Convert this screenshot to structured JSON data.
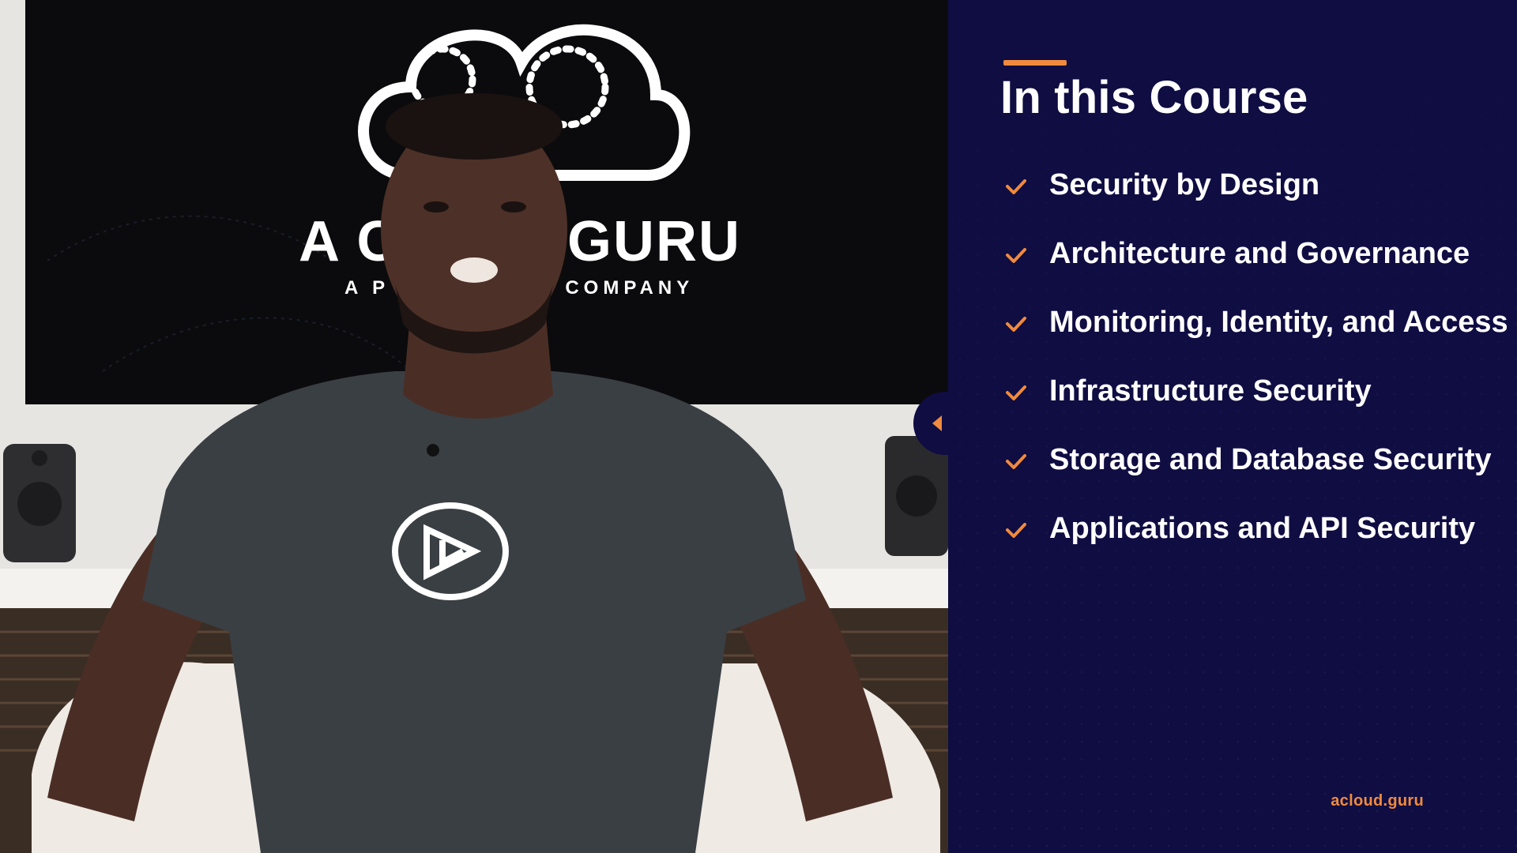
{
  "video": {
    "backdrop_logo_text": "A CLOUD GURU",
    "backdrop_tagline": "A PLURALSIGHT COMPANY"
  },
  "panel": {
    "title": "In this Course",
    "items": [
      {
        "label": "Security by Design",
        "icon": "check-icon"
      },
      {
        "label": "Architecture and Governance",
        "icon": "check-icon"
      },
      {
        "label": "Monitoring, Identity, and Access",
        "icon": "check-icon"
      },
      {
        "label": "Infrastructure Security",
        "icon": "check-icon"
      },
      {
        "label": "Storage and Database Security",
        "icon": "check-icon"
      },
      {
        "label": "Applications and API Security",
        "icon": "check-icon"
      }
    ],
    "brand": "acloud.guru"
  },
  "colors": {
    "panel_bg": "#0f0d42",
    "accent": "#f08a3e",
    "text": "#ffffff"
  }
}
